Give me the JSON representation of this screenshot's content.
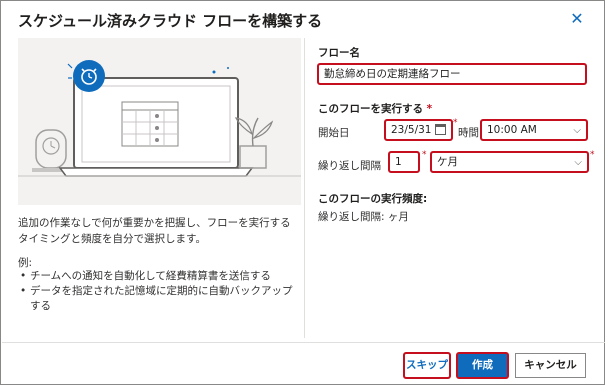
{
  "dialog": {
    "title": "スケジュール済みクラウド フローを構築する",
    "close_icon": "close-icon"
  },
  "left": {
    "description": "追加の作業なしで何が重要かを把握し、フローを実行するタイミングと頻度を自分で選択します。",
    "example_label": "例:",
    "examples": [
      "チームへの通知を自動化して経費精算書を送信する",
      "データを指定された記憶域に定期的に自動バックアップする"
    ]
  },
  "form": {
    "flow_name_label": "フロー名",
    "flow_name_value": "勤怠締め日の定期連絡フロー",
    "run_section_label": "このフローを実行する",
    "required_mark": "*",
    "start_date_label": "開始日",
    "start_date_value": "23/5/31",
    "time_label": "時間",
    "time_value": "10:00 AM",
    "repeat_label": "繰り返し間隔",
    "repeat_count_value": "1",
    "repeat_unit_value": "ケ月",
    "frequency_heading": "このフローの実行頻度:",
    "frequency_text": "繰り返し間隔: ヶ月"
  },
  "footer": {
    "skip_label": "スキップ",
    "create_label": "作成",
    "cancel_label": "キャンセル"
  },
  "colors": {
    "accent": "#0f6cbd",
    "highlight": "#c50f1f"
  }
}
